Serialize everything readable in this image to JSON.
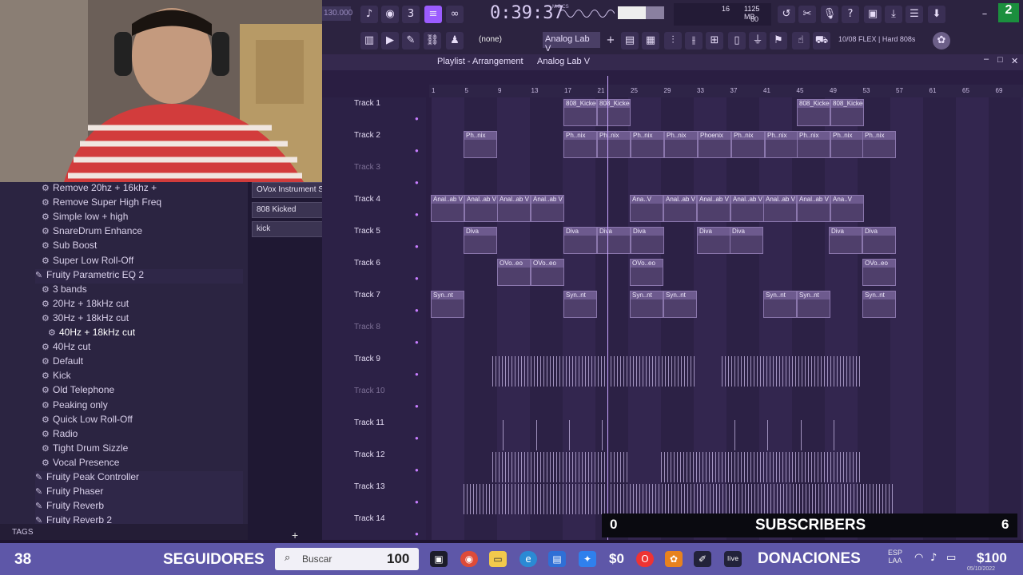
{
  "toolbar": {
    "tempo": "130.000",
    "time": "0:39:37",
    "time_unit": "M:S:CS",
    "cpu_count": "16",
    "memory": "1125 MB",
    "voices": "60",
    "pattern_none": "(none)",
    "current_plugin": "Analog Lab V",
    "news": "10/08 FLEX | Hard 808s",
    "badge": "2"
  },
  "playlist": {
    "title": "Playlist - Arrangement",
    "plugin": "Analog Lab V",
    "ruler": [
      "1",
      "5",
      "9",
      "13",
      "17",
      "21",
      "25",
      "29",
      "33",
      "37",
      "41",
      "45",
      "49",
      "53",
      "57",
      "61",
      "65",
      "69"
    ],
    "tracks": [
      {
        "name": "Track 1"
      },
      {
        "name": "Track 2"
      },
      {
        "name": "Track 3"
      },
      {
        "name": "Track 4"
      },
      {
        "name": "Track 5"
      },
      {
        "name": "Track 6"
      },
      {
        "name": "Track 7"
      },
      {
        "name": "Track 8"
      },
      {
        "name": "Track 9"
      },
      {
        "name": "Track 10"
      },
      {
        "name": "Track 11"
      },
      {
        "name": "Track 12"
      },
      {
        "name": "Track 13"
      },
      {
        "name": "Track 14"
      }
    ],
    "clip_labels": {
      "t1": "808_Kicked",
      "t2": "Ph..nix",
      "t2b": "Phoenix",
      "t4": "Anal..ab V",
      "t4b": "Ana..V",
      "t5": "Diva",
      "t6": "OVo..eo",
      "t7": "Syn..nt"
    }
  },
  "channels": [
    "OVox Instrument Stereo",
    "808 Kicked",
    "kick"
  ],
  "browser": {
    "items": [
      {
        "label": "Remove 20hz + 16khz +",
        "type": "preset"
      },
      {
        "label": "Remove Super High Freq",
        "type": "preset"
      },
      {
        "label": "Simple low + high",
        "type": "preset"
      },
      {
        "label": "SnareDrum Enhance",
        "type": "preset"
      },
      {
        "label": "Sub Boost",
        "type": "preset"
      },
      {
        "label": "Super Low Roll-Off",
        "type": "preset"
      },
      {
        "label": "Fruity Parametric EQ 2",
        "type": "plugin"
      },
      {
        "label": "3 bands",
        "type": "preset"
      },
      {
        "label": "20Hz + 18kHz cut",
        "type": "preset"
      },
      {
        "label": "30Hz + 18kHz cut",
        "type": "preset"
      },
      {
        "label": "40Hz + 18kHz cut",
        "type": "preset-selected"
      },
      {
        "label": "40Hz cut",
        "type": "preset"
      },
      {
        "label": "Default",
        "type": "preset"
      },
      {
        "label": "Kick",
        "type": "preset"
      },
      {
        "label": "Old Telephone",
        "type": "preset"
      },
      {
        "label": "Peaking only",
        "type": "preset"
      },
      {
        "label": "Quick Low Roll-Off",
        "type": "preset"
      },
      {
        "label": "Radio",
        "type": "preset"
      },
      {
        "label": "Tight Drum Sizzle",
        "type": "preset"
      },
      {
        "label": "Vocal Presence",
        "type": "preset"
      },
      {
        "label": "Fruity Peak Controller",
        "type": "plugin"
      },
      {
        "label": "Fruity Phaser",
        "type": "plugin"
      },
      {
        "label": "Fruity Reverb",
        "type": "plugin"
      },
      {
        "label": "Fruity Reverb 2",
        "type": "plugin"
      }
    ],
    "tags_label": "TAGS"
  },
  "overlay": {
    "subs_left": "0",
    "subs_label": "SUBSCRIBERS",
    "subs_right": "6"
  },
  "taskbar": {
    "followers_count": "38",
    "followers_label": "SEGUIDORES",
    "search_placeholder": "Buscar",
    "search_count": "100",
    "money_left": "$0",
    "donations_label": "DONACIONES",
    "language": "ESP",
    "language_sub": "LAA",
    "money_right": "$100",
    "date": "05/10/2022"
  },
  "colors": {
    "accent": "#9b5cff",
    "bg": "#2a1e42",
    "taskbar": "#5e57a8"
  }
}
